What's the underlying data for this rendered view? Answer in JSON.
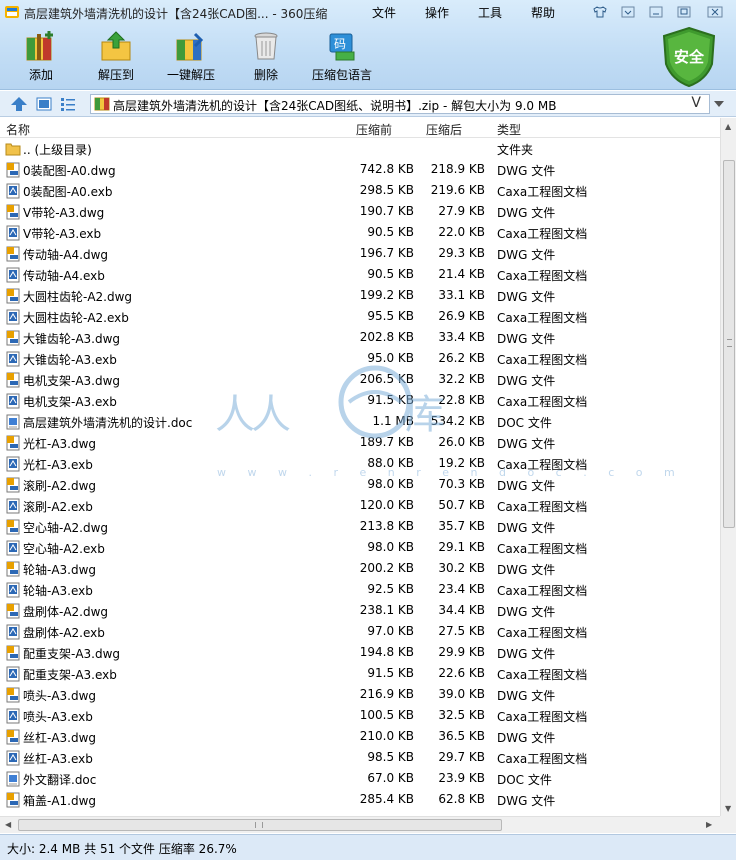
{
  "window": {
    "title": "高层建筑外墙清洗机的设计【含24张CAD图... - 360压缩"
  },
  "menu": [
    "文件",
    "操作",
    "工具",
    "帮助"
  ],
  "toolbar": {
    "tools": [
      {
        "label": "添加",
        "icon": "add-archive-icon"
      },
      {
        "label": "解压到",
        "icon": "extract-to-icon"
      },
      {
        "label": "一键解压",
        "icon": "one-click-extract-icon"
      },
      {
        "label": "删除",
        "icon": "trash-icon"
      },
      {
        "label": "压缩包语言",
        "icon": "archive-language-icon"
      }
    ],
    "badge": "安全"
  },
  "address": {
    "path": "高层建筑外墙清洗机的设计【含24张CAD图纸、说明书】.zip - 解包大小为 9.0 MB",
    "history_glyph": "V"
  },
  "columns": {
    "name": "名称",
    "compressed": "压缩前",
    "original": "压缩后",
    "type": "类型"
  },
  "files": [
    {
      "name": ".. (上级目录)",
      "before": "",
      "after": "",
      "type": "文件夹",
      "kind": "folder"
    },
    {
      "name": "0装配图-A0.dwg",
      "before": "742.8 KB",
      "after": "218.9 KB",
      "type": "DWG 文件",
      "kind": "dwg"
    },
    {
      "name": "0装配图-A0.exb",
      "before": "298.5 KB",
      "after": "219.6 KB",
      "type": "Caxa工程图文档",
      "kind": "exb"
    },
    {
      "name": "V带轮-A3.dwg",
      "before": "190.7 KB",
      "after": "27.9 KB",
      "type": "DWG 文件",
      "kind": "dwg"
    },
    {
      "name": "V带轮-A3.exb",
      "before": "90.5 KB",
      "after": "22.0 KB",
      "type": "Caxa工程图文档",
      "kind": "exb"
    },
    {
      "name": "传动轴-A4.dwg",
      "before": "196.7 KB",
      "after": "29.3 KB",
      "type": "DWG 文件",
      "kind": "dwg"
    },
    {
      "name": "传动轴-A4.exb",
      "before": "90.5 KB",
      "after": "21.4 KB",
      "type": "Caxa工程图文档",
      "kind": "exb"
    },
    {
      "name": "大圆柱齿轮-A2.dwg",
      "before": "199.2 KB",
      "after": "33.1 KB",
      "type": "DWG 文件",
      "kind": "dwg"
    },
    {
      "name": "大圆柱齿轮-A2.exb",
      "before": "95.5 KB",
      "after": "26.9 KB",
      "type": "Caxa工程图文档",
      "kind": "exb"
    },
    {
      "name": "大锥齿轮-A3.dwg",
      "before": "202.8 KB",
      "after": "33.4 KB",
      "type": "DWG 文件",
      "kind": "dwg"
    },
    {
      "name": "大锥齿轮-A3.exb",
      "before": "95.0 KB",
      "after": "26.2 KB",
      "type": "Caxa工程图文档",
      "kind": "exb"
    },
    {
      "name": "电机支架-A3.dwg",
      "before": "206.5 KB",
      "after": "32.2 KB",
      "type": "DWG 文件",
      "kind": "dwg"
    },
    {
      "name": "电机支架-A3.exb",
      "before": "91.5 KB",
      "after": "22.8 KB",
      "type": "Caxa工程图文档",
      "kind": "exb"
    },
    {
      "name": "高层建筑外墙清洗机的设计.doc",
      "before": "1.1 MB",
      "after": "534.2 KB",
      "type": "DOC 文件",
      "kind": "doc"
    },
    {
      "name": "光杠-A3.dwg",
      "before": "189.7 KB",
      "after": "26.0 KB",
      "type": "DWG 文件",
      "kind": "dwg"
    },
    {
      "name": "光杠-A3.exb",
      "before": "88.0 KB",
      "after": "19.2 KB",
      "type": "Caxa工程图文档",
      "kind": "exb"
    },
    {
      "name": "滚刷-A2.dwg",
      "before": "98.0 KB",
      "after": "70.3 KB",
      "type": "DWG 文件",
      "kind": "dwg"
    },
    {
      "name": "滚刷-A2.exb",
      "before": "120.0 KB",
      "after": "50.7 KB",
      "type": "Caxa工程图文档",
      "kind": "exb"
    },
    {
      "name": "空心轴-A2.dwg",
      "before": "213.8 KB",
      "after": "35.7 KB",
      "type": "DWG 文件",
      "kind": "dwg"
    },
    {
      "name": "空心轴-A2.exb",
      "before": "98.0 KB",
      "after": "29.1 KB",
      "type": "Caxa工程图文档",
      "kind": "exb"
    },
    {
      "name": "轮轴-A3.dwg",
      "before": "200.2 KB",
      "after": "30.2 KB",
      "type": "DWG 文件",
      "kind": "dwg"
    },
    {
      "name": "轮轴-A3.exb",
      "before": "92.5 KB",
      "after": "23.4 KB",
      "type": "Caxa工程图文档",
      "kind": "exb"
    },
    {
      "name": "盘刷体-A2.dwg",
      "before": "238.1 KB",
      "after": "34.4 KB",
      "type": "DWG 文件",
      "kind": "dwg"
    },
    {
      "name": "盘刷体-A2.exb",
      "before": "97.0 KB",
      "after": "27.5 KB",
      "type": "Caxa工程图文档",
      "kind": "exb"
    },
    {
      "name": "配重支架-A3.dwg",
      "before": "194.8 KB",
      "after": "29.9 KB",
      "type": "DWG 文件",
      "kind": "dwg"
    },
    {
      "name": "配重支架-A3.exb",
      "before": "91.5 KB",
      "after": "22.6 KB",
      "type": "Caxa工程图文档",
      "kind": "exb"
    },
    {
      "name": "喷头-A3.dwg",
      "before": "216.9 KB",
      "after": "39.0 KB",
      "type": "DWG 文件",
      "kind": "dwg"
    },
    {
      "name": "喷头-A3.exb",
      "before": "100.5 KB",
      "after": "32.5 KB",
      "type": "Caxa工程图文档",
      "kind": "exb"
    },
    {
      "name": "丝杠-A3.dwg",
      "before": "210.0 KB",
      "after": "36.5 KB",
      "type": "DWG 文件",
      "kind": "dwg"
    },
    {
      "name": "丝杠-A3.exb",
      "before": "98.5 KB",
      "after": "29.7 KB",
      "type": "Caxa工程图文档",
      "kind": "exb"
    },
    {
      "name": "外文翻译.doc",
      "before": "67.0 KB",
      "after": "23.9 KB",
      "type": "DOC 文件",
      "kind": "doc"
    },
    {
      "name": "箱盖-A1.dwg",
      "before": "285.4 KB",
      "after": "62.8 KB",
      "type": "DWG 文件",
      "kind": "dwg"
    }
  ],
  "status": {
    "text": "大小: 2.4 MB 共 51 个文件 压缩率 26.7%"
  },
  "watermark": {
    "chars_left": "人人",
    "chars_right": "库",
    "url": "w w w . r e n r e n d o c . c o m"
  },
  "colors": {
    "accent": "#3a7fc8",
    "badge_green": "#3f9a2e",
    "dwg_icon": "#e8a000",
    "exb_icon": "#2c68b5"
  }
}
